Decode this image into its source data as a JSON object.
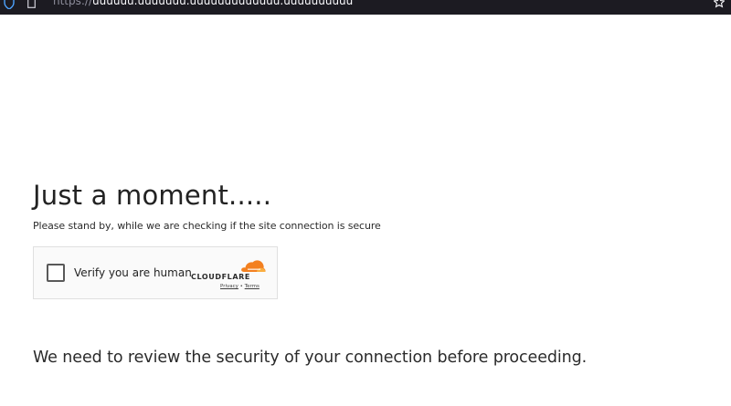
{
  "browser": {
    "url_prefix": "https://",
    "url_host": "uuuuuu.uuuuuuu.uuuuuuuuuuuuu.uuuuuuuuuu",
    "icons": [
      "shield-icon",
      "page-icon",
      "bookmark-icon"
    ]
  },
  "page": {
    "heading": "Just a moment.....",
    "subtitle": "Please stand by, while we are checking if the site connection is secure",
    "notice": "We need to review the security of your connection before proceeding."
  },
  "widget": {
    "checkbox_label": "Verify you are human",
    "checked": false,
    "brand": "CLOUDFLARE",
    "privacy_link": "Privacy",
    "separator": "•",
    "terms_link": "Terms",
    "brand_color": "#f38020"
  }
}
